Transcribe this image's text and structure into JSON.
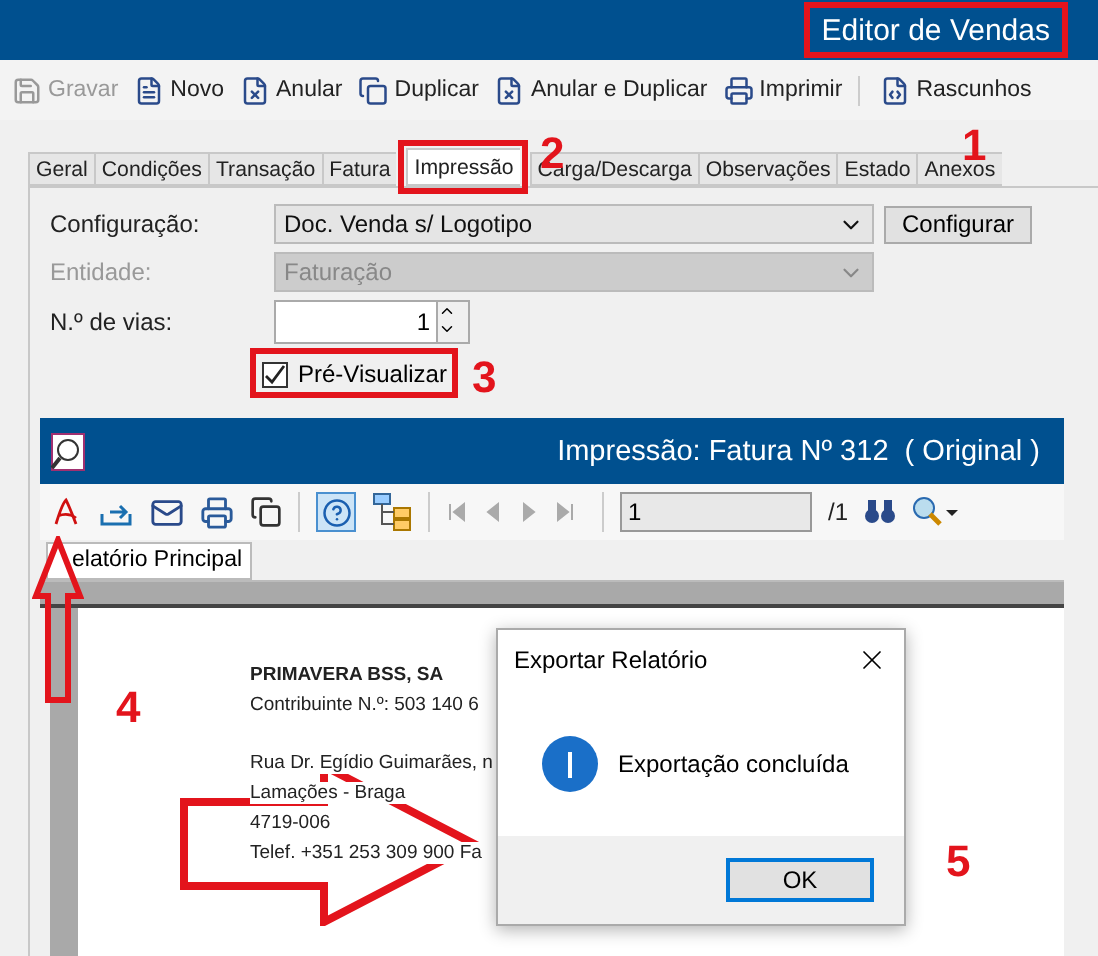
{
  "window": {
    "title": "Editor de Vendas"
  },
  "toolbar": [
    {
      "label": "Gravar",
      "disabled": true
    },
    {
      "label": "Novo",
      "disabled": false
    },
    {
      "label": "Anular",
      "disabled": false
    },
    {
      "label": "Duplicar",
      "disabled": false
    },
    {
      "label": "Anular e Duplicar",
      "disabled": false
    },
    {
      "label": "Imprimir",
      "disabled": false
    },
    {
      "label": "Rascunhos",
      "disabled": false
    }
  ],
  "tabs": [
    {
      "label": "Geral",
      "selected": false
    },
    {
      "label": "Condições",
      "selected": false
    },
    {
      "label": "Transação",
      "selected": false
    },
    {
      "label": "Fatura",
      "selected": false
    },
    {
      "label": "Impressão",
      "selected": true
    },
    {
      "label": "Carga/Descarga",
      "selected": false
    },
    {
      "label": "Observações",
      "selected": false
    },
    {
      "label": "Estado",
      "selected": false
    },
    {
      "label": "Anexos",
      "selected": false
    }
  ],
  "form": {
    "configuracao": {
      "label": "Configuração:",
      "value": "Doc. Venda s/ Logotipo",
      "button": "Configurar",
      "disabled": false
    },
    "entidade": {
      "label": "Entidade:",
      "value": "Faturação",
      "disabled": true
    },
    "vias": {
      "label": "N.º de vias:",
      "value": "1"
    },
    "preview": {
      "label": "Pré-Visualizar",
      "checked": true
    }
  },
  "preview_window": {
    "title": "Impressão: Fatura Nº 312  ( Original )",
    "page_field": "1",
    "page_count": "/1",
    "report_tab": "elatório Principal",
    "company": "PRIMAVERA BSS, SA",
    "tax_line": "Contribuinte N.º: 503 140 6",
    "address_lines": [
      "Rua Dr. Egídio Guimarães, n",
      "Lamações - Braga",
      "4719-006",
      "Telef. +351 253 309 900  Fa"
    ]
  },
  "dialog": {
    "title": "Exportar Relatório",
    "message": "Exportação concluída",
    "button": "OK"
  },
  "annotations": [
    "1",
    "2",
    "3",
    "4",
    "5"
  ]
}
